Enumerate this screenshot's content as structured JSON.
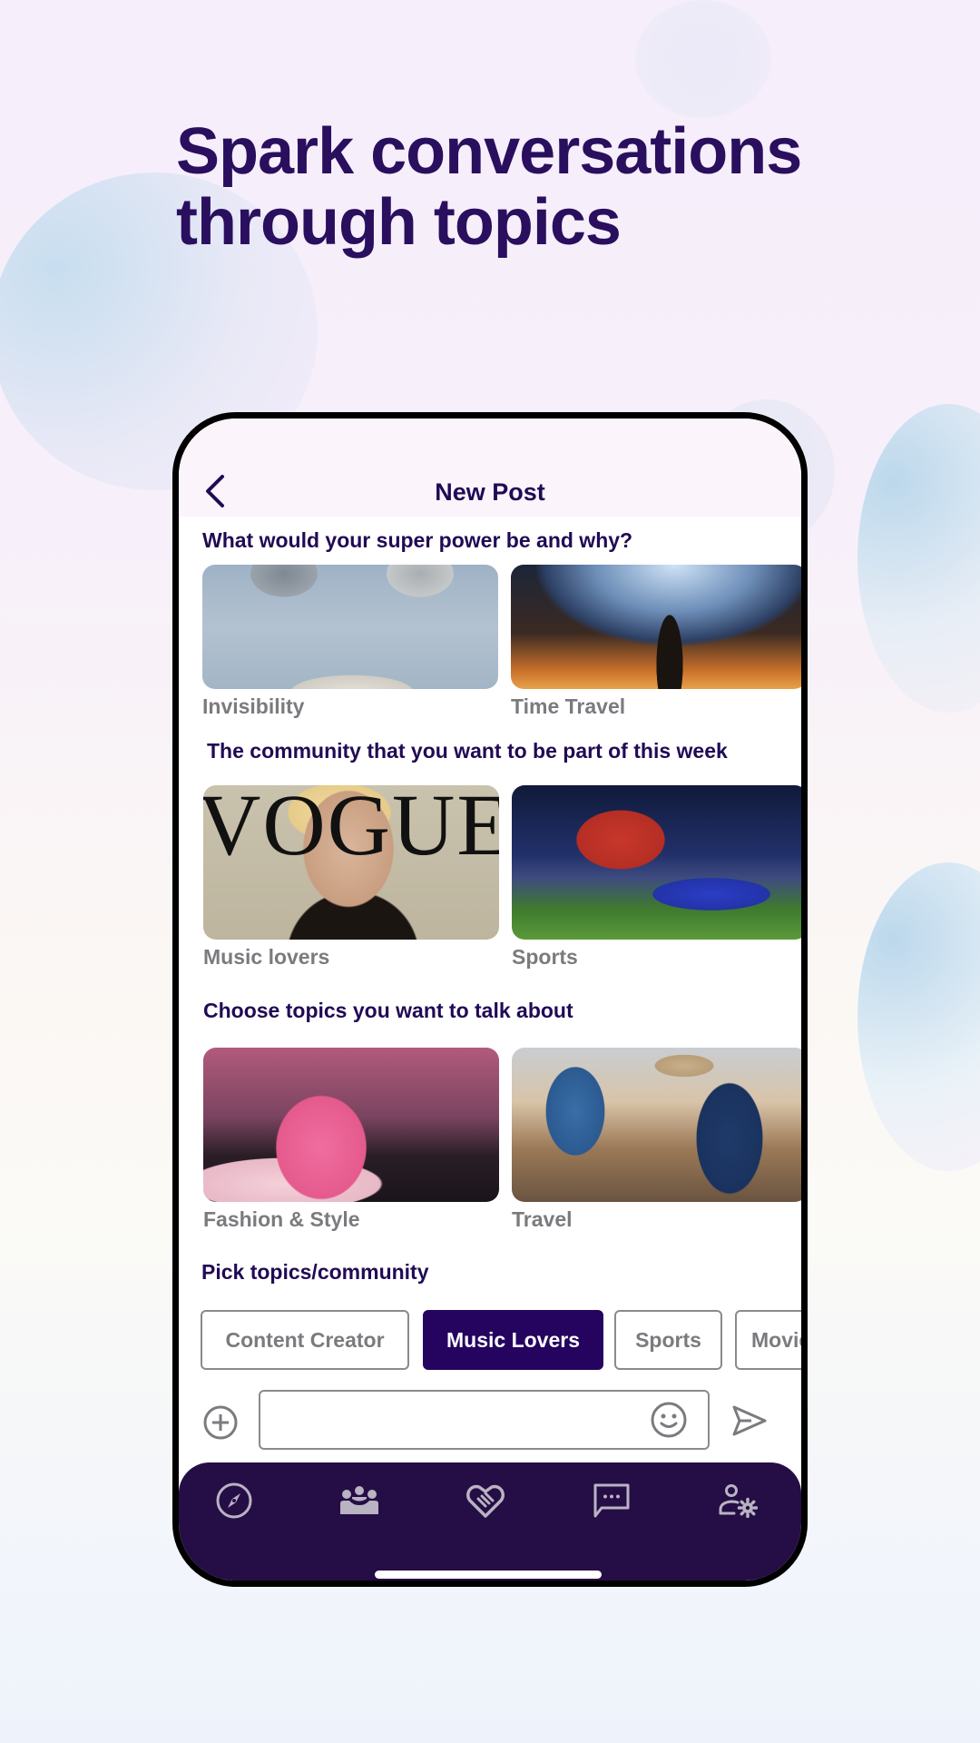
{
  "headline": {
    "line1": "Spark conversations",
    "line2": "through topics"
  },
  "app": {
    "nav": {
      "back_icon": "chevron-left-icon",
      "title": "New Post"
    },
    "sections": [
      {
        "title": "What would your super power be and why?",
        "cards": [
          {
            "label": "Invisibility",
            "image": "invisible-man-with-sunglasses"
          },
          {
            "label": "Time Travel",
            "image": "man-facing-giant-clock-portal"
          }
        ]
      },
      {
        "title": "The community that you want to be part of this week",
        "cards": [
          {
            "label": "Music lovers",
            "image": "vogue-magazine-cover",
            "cover_text": "VOGUE"
          },
          {
            "label": "Sports",
            "image": "american-football-players"
          }
        ]
      },
      {
        "title": "Choose topics you want to talk about",
        "cards": [
          {
            "label": "Fashion & Style",
            "image": "woman-in-pink-gown"
          },
          {
            "label": "Travel",
            "image": "backpacker-at-train-station"
          }
        ]
      }
    ],
    "pick": {
      "title": "Pick topics/community",
      "chips": [
        {
          "label": "Content Creator",
          "selected": false
        },
        {
          "label": "Music Lovers",
          "selected": true
        },
        {
          "label": "Sports",
          "selected": false
        },
        {
          "label": "Movies",
          "selected": false
        }
      ]
    },
    "composer": {
      "add_icon": "plus-circle-icon",
      "input_value": "",
      "input_placeholder": "",
      "emoji_icon": "smiley-icon",
      "send_icon": "send-icon"
    },
    "tabbar": {
      "items": [
        {
          "name": "explore",
          "icon": "compass-icon"
        },
        {
          "name": "communities",
          "icon": "group-icon"
        },
        {
          "name": "connections",
          "icon": "handshake-heart-icon"
        },
        {
          "name": "messages",
          "icon": "chat-bubble-icon"
        },
        {
          "name": "profile-settings",
          "icon": "user-settings-icon"
        }
      ]
    },
    "colors": {
      "brand_dark": "#250460",
      "tabbar_bg": "#250d45",
      "heading": "#210a55",
      "label_gray": "#7b7b7f"
    }
  }
}
